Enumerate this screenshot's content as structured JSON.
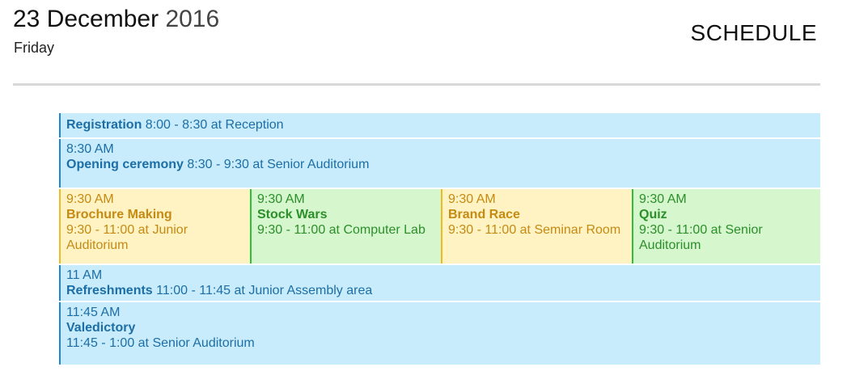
{
  "header": {
    "date": "23 December",
    "year": "2016",
    "weekday": "Friday",
    "title": "SCHEDULE"
  },
  "events": {
    "registration": {
      "name": "Registration",
      "detail": "8:00 - 8:30 at Reception"
    },
    "opening": {
      "time": "8:30 AM",
      "name": "Opening ceremony",
      "detail": "8:30 - 9:30 at Senior Auditorium"
    },
    "brochure": {
      "time": "9:30 AM",
      "name": "Brochure Making",
      "detail": "9:30 - 11:00 at Junior Auditorium"
    },
    "stockwars": {
      "time": "9:30 AM",
      "name": "Stock Wars",
      "detail": "9:30 - 11:00 at Computer Lab"
    },
    "brandrace": {
      "time": "9:30 AM",
      "name": "Brand Race",
      "detail": "9:30 - 11:00 at Seminar Room"
    },
    "quiz": {
      "time": "9:30 AM",
      "name": "Quiz",
      "detail": "9:30 - 11:00 at Senior Auditorium"
    },
    "refreshments": {
      "time": "11 AM",
      "name": "Refreshments",
      "detail": "11:00 - 11:45 at Junior Assembly area"
    },
    "valedictory": {
      "time": "11:45 AM",
      "name": "Valedictory",
      "detail": "11:45 - 1:00 at Senior Auditorium"
    }
  },
  "colors": {
    "blue": "#c8ecfb",
    "yellow": "#fff3c4",
    "green": "#d6f6cd"
  }
}
